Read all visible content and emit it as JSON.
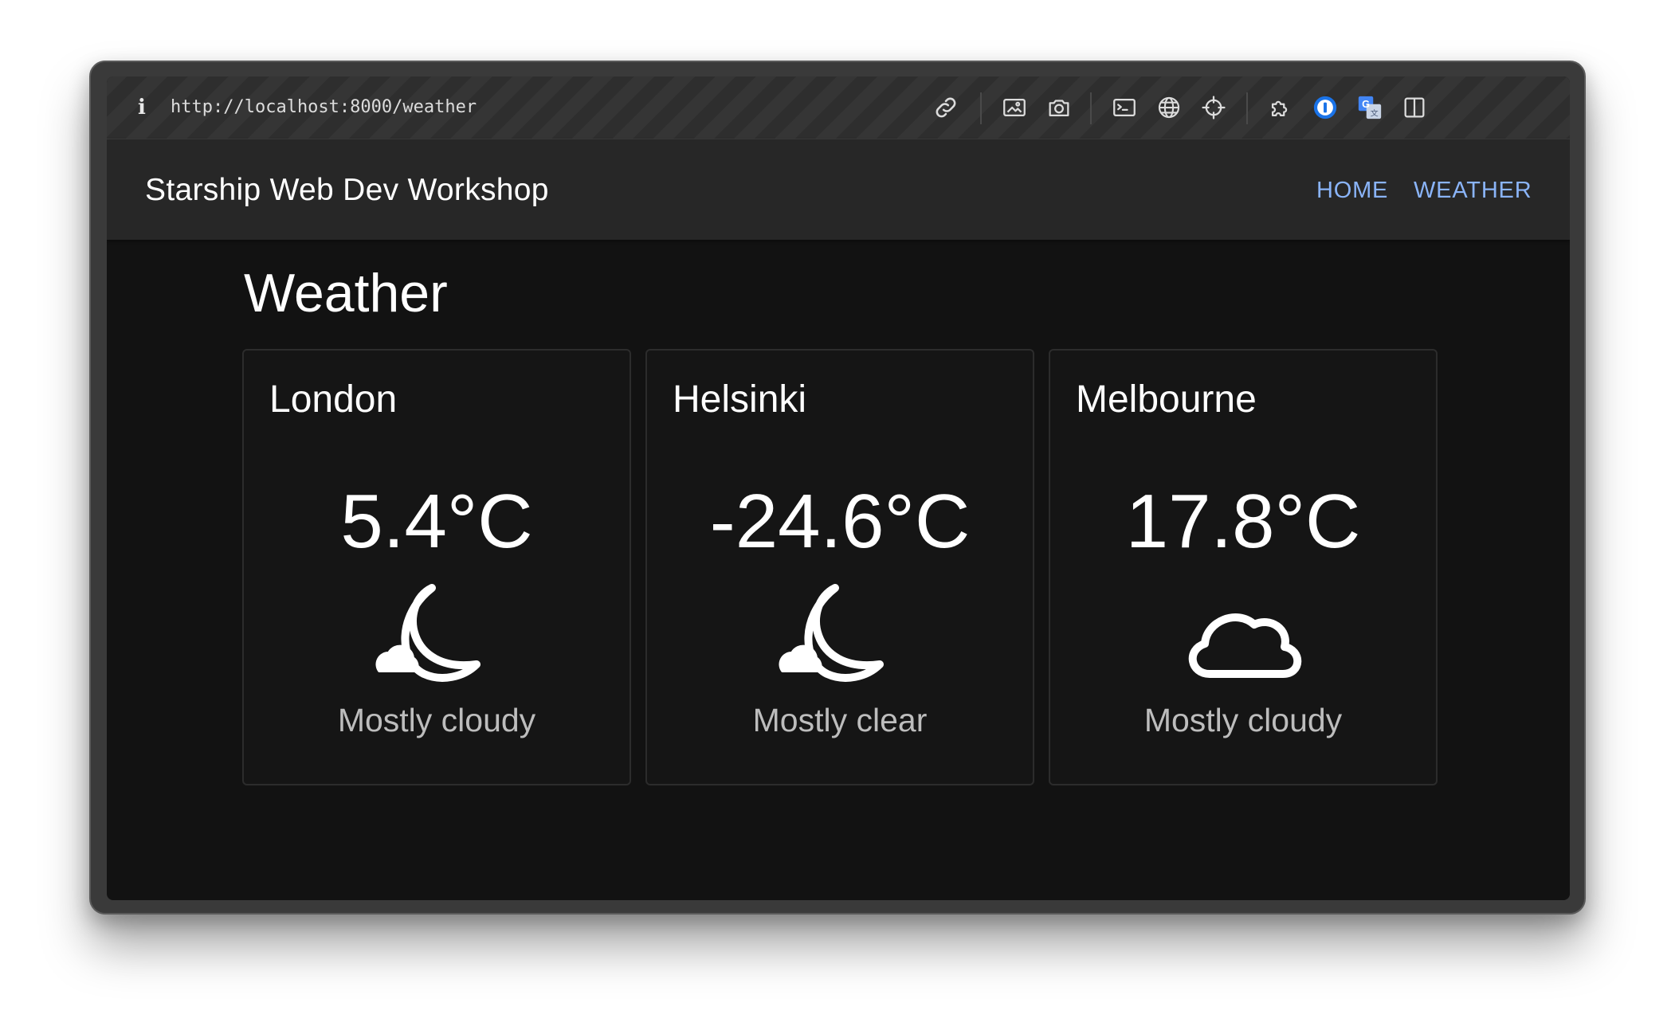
{
  "browser": {
    "url": "http://localhost:8000/weather",
    "info_icon": "i",
    "toolbar_icons": [
      "link-icon",
      "image-icon",
      "camera-icon",
      "terminal-icon",
      "globe-icon",
      "crosshair-icon",
      "extension-icon",
      "password-manager-icon",
      "translate-icon",
      "sidebar-icon"
    ]
  },
  "appbar": {
    "title": "Starship Web Dev Workshop",
    "nav": [
      {
        "label": "HOME"
      },
      {
        "label": "WEATHER"
      }
    ]
  },
  "main": {
    "heading": "Weather",
    "cards": [
      {
        "city": "London",
        "temperature": "5.4°C",
        "icon": "night-cloudy-icon",
        "condition": "Mostly cloudy"
      },
      {
        "city": "Helsinki",
        "temperature": "-24.6°C",
        "icon": "night-cloudy-icon",
        "condition": "Mostly clear"
      },
      {
        "city": "Melbourne",
        "temperature": "17.8°C",
        "icon": "cloud-icon",
        "condition": "Mostly cloudy"
      }
    ]
  },
  "colors": {
    "nav_link": "#8ab4f8",
    "background": "#121212",
    "appbar": "#272727",
    "password_manager_accent": "#1a73e8"
  }
}
